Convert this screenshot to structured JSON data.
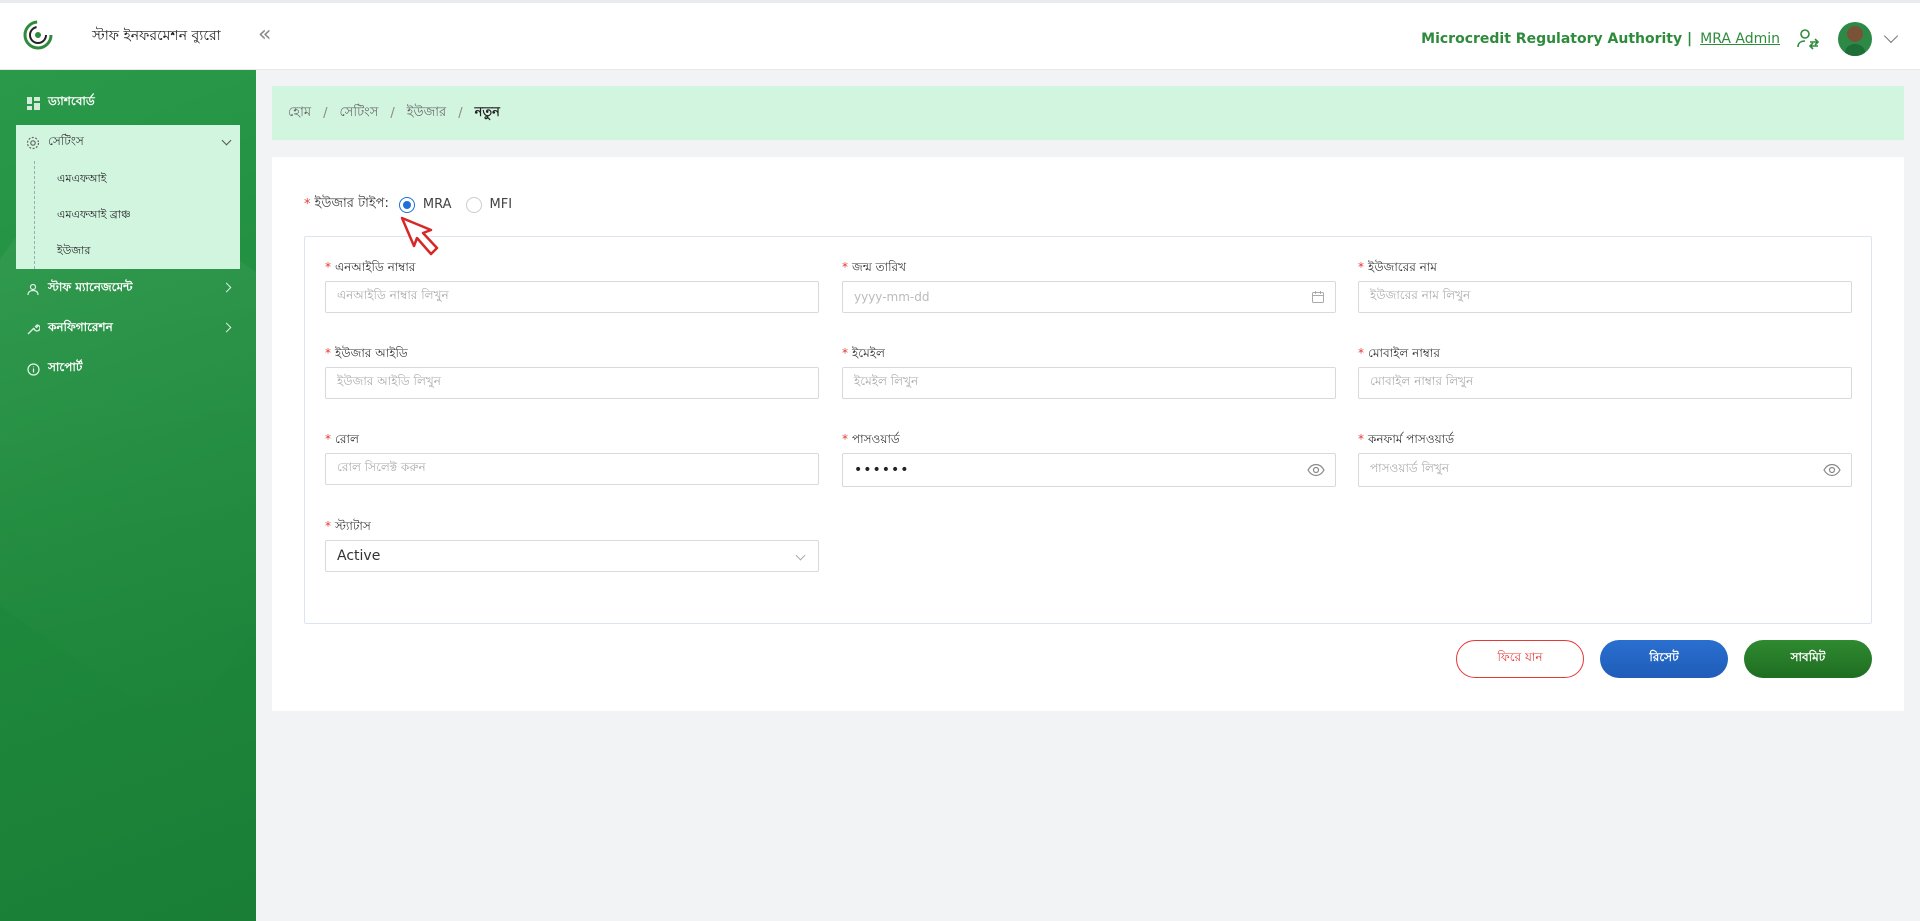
{
  "header": {
    "app_name": "স্টাফ ইনফরমেশন ব্যুরো",
    "logo_text": "Microcredit Regulatory Authority",
    "org_name": "Microcredit Regulatory Authority |",
    "admin_label": "MRA Admin"
  },
  "sidebar": {
    "dashboard": "ড্যাশবোর্ড",
    "settings": "সেটিংস",
    "settings_items": [
      "এমএফআই",
      "এমএফআই ব্রাঞ্চ",
      "ইউজার"
    ],
    "staff_management": "স্টাফ ম্যানেজমেন্ট",
    "configuration": "কনফিগারেশন",
    "support": "সাপোর্ট"
  },
  "breadcrumb": {
    "home": "হোম",
    "settings": "সেটিংস",
    "user": "ইউজার",
    "current": "নতুন"
  },
  "form": {
    "user_type_label": "ইউজার টাইপ:",
    "user_type_options": [
      {
        "label": "MRA",
        "checked": true
      },
      {
        "label": "MFI",
        "checked": false
      }
    ],
    "nid": {
      "label": "এনআইডি নাম্বার",
      "placeholder": "এনআইডি নাম্বার লিখুন"
    },
    "dob": {
      "label": "জন্ম তারিখ",
      "placeholder": "yyyy-mm-dd"
    },
    "username": {
      "label": "ইউজারের নাম",
      "placeholder": "ইউজারের নাম লিখুন"
    },
    "user_id": {
      "label": "ইউজার আইডি",
      "placeholder": "ইউজার আইডি লিখুন"
    },
    "email": {
      "label": "ইমেইল",
      "placeholder": "ইমেইল লিখুন"
    },
    "mobile": {
      "label": "মোবাইল নাম্বার",
      "placeholder": "মোবাইল নাম্বার লিখুন"
    },
    "role": {
      "label": "রোল",
      "placeholder": "রোল সিলেক্ট করুন"
    },
    "password": {
      "label": "পাসওয়ার্ড",
      "value": "••••••"
    },
    "confirm_password": {
      "label": "কনফার্ম পাসওয়ার্ড",
      "placeholder": "পাসওয়ার্ড লিখুন"
    },
    "status": {
      "label": "স্ট্যাটাস",
      "value": "Active"
    }
  },
  "buttons": {
    "back": "ফিরে যান",
    "reset": "রিসেট",
    "submit": "সাবমিট"
  },
  "colors": {
    "brand_green": "#2e8b3b",
    "sidebar_green": "#1e8a3c",
    "light_green": "#d2f5e0",
    "required_red": "#e53935",
    "radio_blue": "#1e6fd9"
  }
}
